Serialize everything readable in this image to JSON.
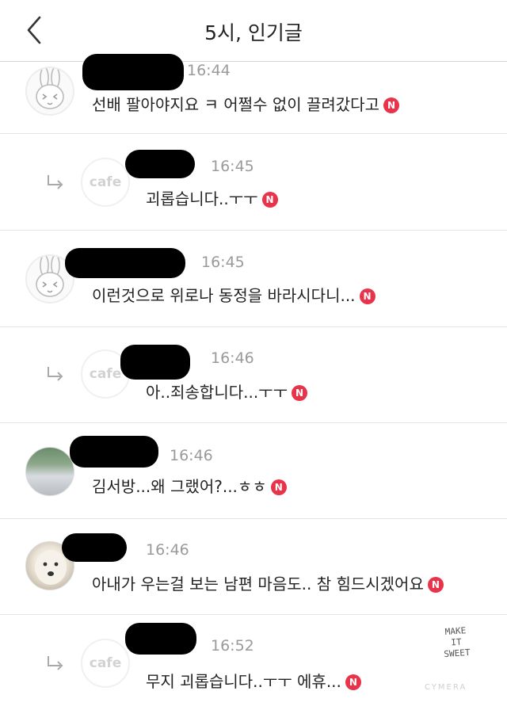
{
  "header": {
    "title": "5시, 인기글",
    "back_icon": "chevron-left-icon"
  },
  "colors": {
    "new_badge": "#e8344a",
    "time": "#9a9a9a",
    "separator": "#e4e4e4"
  },
  "comments": [
    {
      "time": "16:44",
      "text": "선배 팔아야지요 ㅋ 어쩔수 없이 끌려갔다고",
      "badge": "N",
      "avatar": "bunny-avatar",
      "reply": false
    },
    {
      "time": "16:45",
      "text": "괴롭습니다..ㅜㅜ",
      "badge": "N",
      "avatar": "cafe-avatar",
      "avatar_label": "cafe",
      "reply": true
    },
    {
      "time": "16:45",
      "text": "이런것으로 위로나 동정을 바라시다니...",
      "badge": "N",
      "avatar": "bunny-avatar",
      "reply": false
    },
    {
      "time": "16:46",
      "text": "아..죄송합니다...ㅜㅜ",
      "badge": "N",
      "avatar": "cafe-avatar",
      "avatar_label": "cafe",
      "reply": true
    },
    {
      "time": "16:46",
      "text": "김서방...왜 그랬어?...ㅎㅎ",
      "badge": "N",
      "avatar": "photo-avatar",
      "reply": false
    },
    {
      "time": "16:46",
      "text": "아내가 우는걸 보는 남편 마음도.. 참 힘드시겠어요",
      "badge": "N",
      "avatar": "dog-photo-avatar",
      "reply": false
    },
    {
      "time": "16:52",
      "text": "무지 괴롭습니다..ㅜㅜ 에휴...",
      "badge": "N",
      "avatar": "cafe-avatar",
      "avatar_label": "cafe",
      "reply": true
    }
  ],
  "watermark": {
    "line1": "MAKE",
    "line2": "IT",
    "line3": "SWEET",
    "sub": "CYMERA"
  }
}
